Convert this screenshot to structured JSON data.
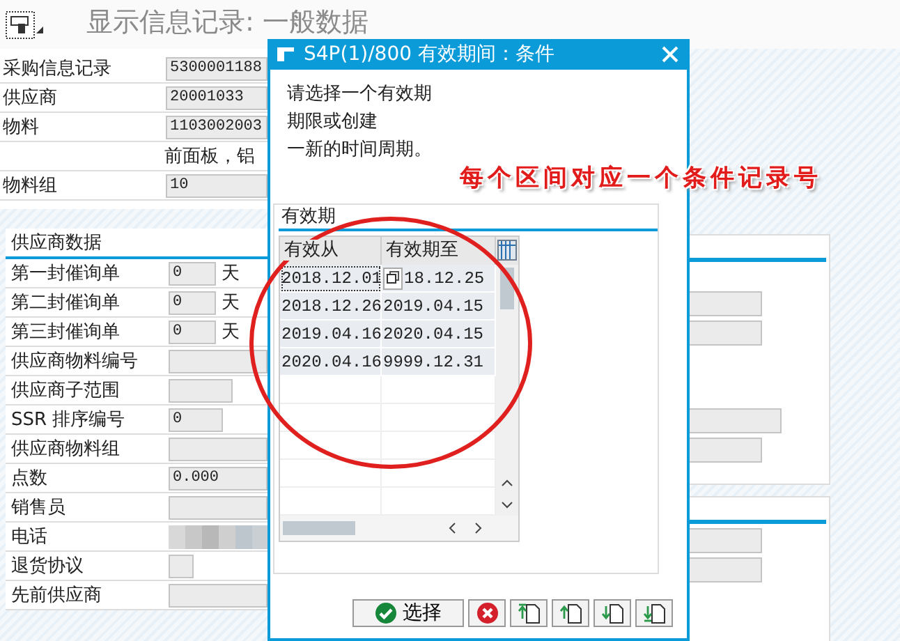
{
  "window": {
    "title": "显示信息记录: 一般数据"
  },
  "header_fields": [
    {
      "kind": "field",
      "label": "采购信息记录",
      "value": "5300001188"
    },
    {
      "kind": "field",
      "label": "供应商",
      "value": "20001033"
    },
    {
      "kind": "field",
      "label": "物料",
      "value": "1103002003"
    },
    {
      "kind": "text",
      "text": "前面板，铝"
    },
    {
      "kind": "field",
      "label": "物料组",
      "value": "10"
    }
  ],
  "vendor_group": {
    "title": "供应商数据",
    "rows": [
      {
        "kind": "field",
        "label": "第一封催询单",
        "value": "0",
        "unit": "天"
      },
      {
        "kind": "field",
        "label": "第二封催询单",
        "value": "0",
        "unit": "天"
      },
      {
        "kind": "field",
        "label": "第三封催询单",
        "value": "0",
        "unit": "天"
      },
      {
        "kind": "field",
        "label": "供应商物料编号"
      },
      {
        "kind": "field",
        "label": "供应商子范围"
      },
      {
        "kind": "field",
        "label": "SSR 排序编号",
        "value": "0"
      },
      {
        "kind": "field",
        "label": "供应商物料组"
      },
      {
        "kind": "field",
        "label": "点数",
        "value": "0.000"
      },
      {
        "kind": "field",
        "label": "销售员"
      },
      {
        "kind": "blurred",
        "label": "电话"
      },
      {
        "kind": "checkbox",
        "label": "退货协议",
        "checked": false
      },
      {
        "kind": "field",
        "label": "先前供应商"
      }
    ]
  },
  "dialog": {
    "title": "S4P(1)/800 有效期间：条件",
    "message": [
      "请选择一个有效期",
      "期限或创建",
      "一新的时间周期。"
    ],
    "group_title": "有效期",
    "table": {
      "columns": [
        "有效从",
        "有效期至"
      ],
      "rows": [
        {
          "valid_from": "2018.12.01",
          "valid_to": "18.12.25",
          "focused": true
        },
        {
          "valid_from": "2018.12.26",
          "valid_to": "2019.04.15",
          "focused": false
        },
        {
          "valid_from": "2019.04.16",
          "valid_to": "2020.04.15",
          "focused": false
        },
        {
          "valid_from": "2020.04.16",
          "valid_to": "9999.12.31",
          "focused": false
        }
      ]
    },
    "buttons": [
      {
        "kind": "confirm",
        "label": "选择"
      },
      {
        "kind": "cancel"
      },
      {
        "kind": "first"
      },
      {
        "kind": "previous"
      },
      {
        "kind": "next"
      },
      {
        "kind": "last"
      }
    ]
  },
  "annotation": {
    "text": "每个区间对应一个条件记录号"
  }
}
